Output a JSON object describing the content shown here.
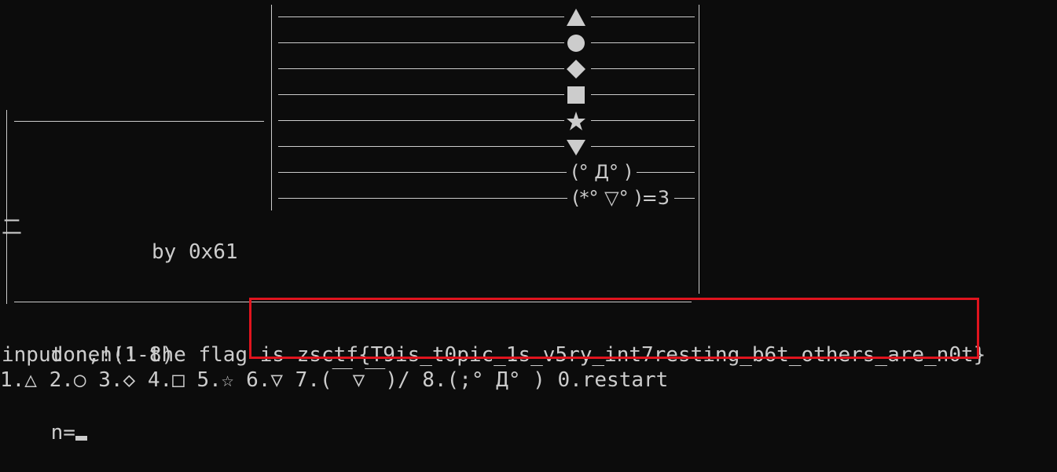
{
  "terminal": {
    "options": [
      {
        "shape": "triangle-up",
        "label": ""
      },
      {
        "shape": "circle",
        "label": ""
      },
      {
        "shape": "diamond",
        "label": ""
      },
      {
        "shape": "square",
        "label": ""
      },
      {
        "shape": "star",
        "label": ""
      },
      {
        "shape": "triangle-down",
        "label": ""
      },
      {
        "shape": "kaomoji",
        "label": "(° Д° )"
      },
      {
        "shape": "kaomoji",
        "label": "(*° ▽° )=3"
      }
    ],
    "glyph_2": "二",
    "byline": "by 0x61",
    "done_prefix": "done!!! the flag is ",
    "flag": "zsctf{T9is_t0pic_1s_v5ry_int7resting_b6t_others_are_n0t}",
    "input_prompt": "input n,n(1-8)",
    "menu": "1.△ 2.○ 3.◇ 4.□ 5.☆ 6.▽ 7.(￣▽￣)/ 8.(;° Д° ) 0.restart",
    "prompt": "n="
  },
  "colors": {
    "background": "#0c0c0c",
    "text": "#cccccc",
    "highlight": "#e0141e"
  }
}
